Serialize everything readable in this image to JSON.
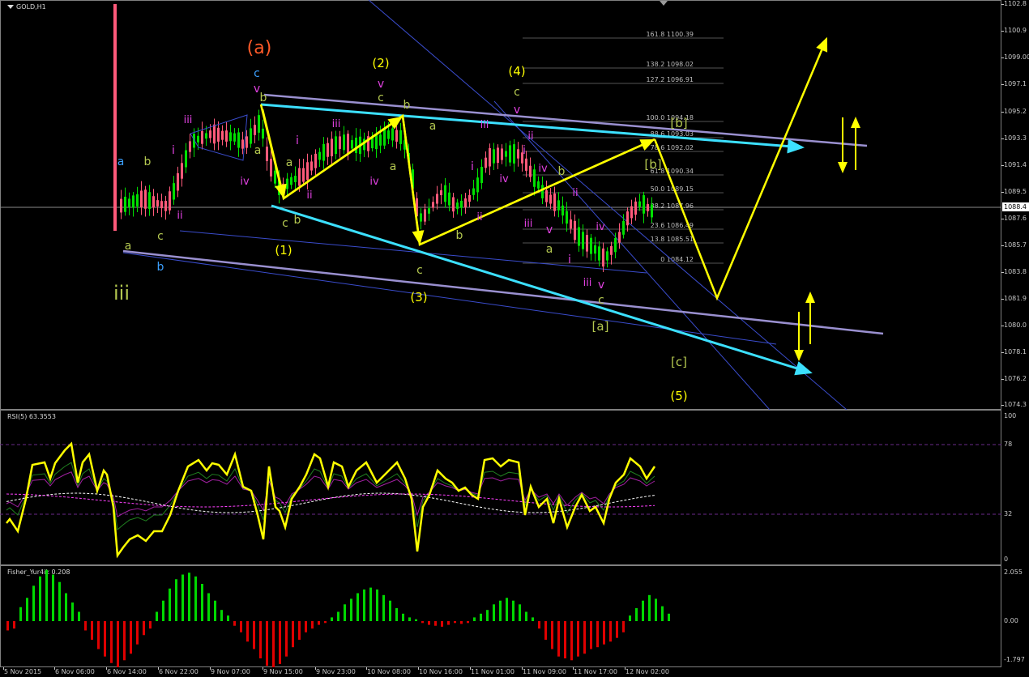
{
  "chart_title": "GOLD,H1",
  "rsi_title": "RSI(5) 63.3553",
  "fisher_title": "Fisher_Yur4ik 0.208",
  "current_price": "1088.4",
  "colors": {
    "bull_candle": "#00e000",
    "bear_candle": "#ff5a7a",
    "projection": "#ffff00",
    "trend_line": "#3ce0ff",
    "channel_line": "#9a90d0",
    "fib_line": "#555555",
    "rsi_line": "#ffff00",
    "fisher_pos": "#00d800",
    "fisher_neg": "#e00000"
  },
  "price_axis": [
    "1102.8",
    "1100.9",
    "1099.00",
    "1097.1",
    "1095.2",
    "1093.3",
    "1091.4",
    "1089.5",
    "1087.6",
    "1085.7",
    "1083.8",
    "1081.9",
    "1080.0",
    "1078.1",
    "1076.2",
    "1074.3"
  ],
  "rsi_axis": [
    "100",
    "78",
    "32",
    "0"
  ],
  "fisher_axis": [
    "2.055",
    "0.00",
    "-1.797"
  ],
  "time_axis": [
    "5 Nov 2015",
    "6 Nov 06:00",
    "6 Nov 14:00",
    "6 Nov 22:00",
    "9 Nov 07:00",
    "9 Nov 15:00",
    "9 Nov 23:00",
    "10 Nov 08:00",
    "10 Nov 16:00",
    "11 Nov 01:00",
    "11 Nov 09:00",
    "11 Nov 17:00",
    "12 Nov 02:00"
  ],
  "fib_levels": [
    "161.8 1100.39",
    "138.2 1098.02",
    "127.2 1096.91",
    "100.0 1094.18",
    "88.6 1093.03",
    "78.6 1092.02",
    "61.8 1090.34",
    "50.0 1089.15",
    "38.2 1087.96",
    "23.6 1086.49",
    "13.8 1085.51",
    "0 1084.12"
  ],
  "wave_labels": {
    "wave_a_major": "(a)",
    "wave_1": "(1)",
    "wave_2": "(2)",
    "wave_3": "(3)",
    "wave_4": "(4)",
    "wave_5": "(5)",
    "a_bracket": "[a]",
    "b_bracket_1": "[b]",
    "b_bracket_2": "[b]",
    "c_bracket": "[c]",
    "iii_big": "iii"
  }
}
